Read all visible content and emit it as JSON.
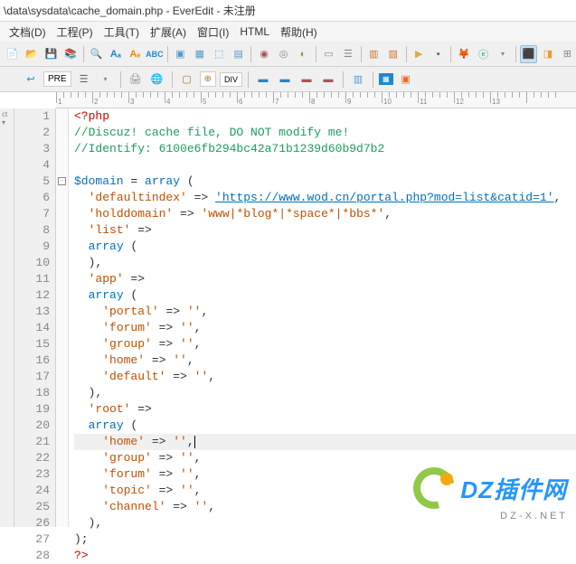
{
  "title": "\\data\\sysdata\\cache_domain.php - EverEdit - 未注册",
  "menu": [
    "文档(D)",
    "工程(P)",
    "工具(T)",
    "扩展(A)",
    "窗口(I)",
    "HTML",
    "帮助(H)"
  ],
  "toolbar2": {
    "pre_label": "PRE"
  },
  "ruler": {
    "marks": [
      1,
      2,
      3,
      4,
      5,
      6,
      7,
      8,
      9,
      10,
      11,
      12,
      13
    ]
  },
  "code": {
    "lines": [
      {
        "n": 1,
        "t": "php_open",
        "txt": "<?php"
      },
      {
        "n": 2,
        "t": "comment",
        "txt": "//Discuz! cache file, DO NOT modify me!"
      },
      {
        "n": 3,
        "t": "comment",
        "txt": "//Identify: 6100e6fb294bc42a71b1239d60b9d7b2"
      },
      {
        "n": 4,
        "t": "blank",
        "txt": ""
      },
      {
        "n": 5,
        "t": "code",
        "fold": true,
        "parts": [
          {
            "c": "var",
            "v": "$domain"
          },
          {
            "c": "",
            "v": " = "
          },
          {
            "c": "kw",
            "v": "array"
          },
          {
            "c": "",
            "v": " ("
          }
        ]
      },
      {
        "n": 6,
        "t": "code",
        "parts": [
          {
            "c": "",
            "v": "  "
          },
          {
            "c": "str",
            "v": "'defaultindex'"
          },
          {
            "c": "",
            "v": " => "
          },
          {
            "c": "str link",
            "v": "'https://www.wod.cn/portal.php?mod=list&catid=1'"
          },
          {
            "c": "",
            "v": ","
          }
        ]
      },
      {
        "n": 7,
        "t": "code",
        "parts": [
          {
            "c": "",
            "v": "  "
          },
          {
            "c": "str",
            "v": "'holddomain'"
          },
          {
            "c": "",
            "v": " => "
          },
          {
            "c": "str",
            "v": "'www|*blog*|*space*|*bbs*'"
          },
          {
            "c": "",
            "v": ","
          }
        ]
      },
      {
        "n": 8,
        "t": "code",
        "parts": [
          {
            "c": "",
            "v": "  "
          },
          {
            "c": "str",
            "v": "'list'"
          },
          {
            "c": "",
            "v": " => "
          }
        ]
      },
      {
        "n": 9,
        "t": "code",
        "parts": [
          {
            "c": "",
            "v": "  "
          },
          {
            "c": "kw",
            "v": "array"
          },
          {
            "c": "",
            "v": " ("
          }
        ]
      },
      {
        "n": 10,
        "t": "code",
        "parts": [
          {
            "c": "",
            "v": "  ),"
          }
        ]
      },
      {
        "n": 11,
        "t": "code",
        "parts": [
          {
            "c": "",
            "v": "  "
          },
          {
            "c": "str",
            "v": "'app'"
          },
          {
            "c": "",
            "v": " => "
          }
        ]
      },
      {
        "n": 12,
        "t": "code",
        "parts": [
          {
            "c": "",
            "v": "  "
          },
          {
            "c": "kw",
            "v": "array"
          },
          {
            "c": "",
            "v": " ("
          }
        ]
      },
      {
        "n": 13,
        "t": "code",
        "parts": [
          {
            "c": "",
            "v": "    "
          },
          {
            "c": "str",
            "v": "'portal'"
          },
          {
            "c": "",
            "v": " => "
          },
          {
            "c": "str",
            "v": "''"
          },
          {
            "c": "",
            "v": ","
          }
        ]
      },
      {
        "n": 14,
        "t": "code",
        "parts": [
          {
            "c": "",
            "v": "    "
          },
          {
            "c": "str",
            "v": "'forum'"
          },
          {
            "c": "",
            "v": " => "
          },
          {
            "c": "str",
            "v": "''"
          },
          {
            "c": "",
            "v": ","
          }
        ]
      },
      {
        "n": 15,
        "t": "code",
        "parts": [
          {
            "c": "",
            "v": "    "
          },
          {
            "c": "str",
            "v": "'group'"
          },
          {
            "c": "",
            "v": " => "
          },
          {
            "c": "str",
            "v": "''"
          },
          {
            "c": "",
            "v": ","
          }
        ]
      },
      {
        "n": 16,
        "t": "code",
        "parts": [
          {
            "c": "",
            "v": "    "
          },
          {
            "c": "str",
            "v": "'home'"
          },
          {
            "c": "",
            "v": " => "
          },
          {
            "c": "str",
            "v": "''"
          },
          {
            "c": "",
            "v": ","
          }
        ]
      },
      {
        "n": 17,
        "t": "code",
        "parts": [
          {
            "c": "",
            "v": "    "
          },
          {
            "c": "str",
            "v": "'default'"
          },
          {
            "c": "",
            "v": " => "
          },
          {
            "c": "str",
            "v": "''"
          },
          {
            "c": "",
            "v": ","
          }
        ]
      },
      {
        "n": 18,
        "t": "code",
        "parts": [
          {
            "c": "",
            "v": "  ),"
          }
        ]
      },
      {
        "n": 19,
        "t": "code",
        "parts": [
          {
            "c": "",
            "v": "  "
          },
          {
            "c": "str",
            "v": "'root'"
          },
          {
            "c": "",
            "v": " => "
          }
        ]
      },
      {
        "n": 20,
        "t": "code",
        "parts": [
          {
            "c": "",
            "v": "  "
          },
          {
            "c": "kw",
            "v": "array"
          },
          {
            "c": "",
            "v": " ("
          }
        ]
      },
      {
        "n": 21,
        "t": "code",
        "hl": true,
        "cursor": true,
        "parts": [
          {
            "c": "",
            "v": "    "
          },
          {
            "c": "str",
            "v": "'home'"
          },
          {
            "c": "",
            "v": " => "
          },
          {
            "c": "str",
            "v": "''"
          },
          {
            "c": "",
            "v": ","
          }
        ]
      },
      {
        "n": 22,
        "t": "code",
        "parts": [
          {
            "c": "",
            "v": "    "
          },
          {
            "c": "str",
            "v": "'group'"
          },
          {
            "c": "",
            "v": " => "
          },
          {
            "c": "str",
            "v": "''"
          },
          {
            "c": "",
            "v": ","
          }
        ]
      },
      {
        "n": 23,
        "t": "code",
        "parts": [
          {
            "c": "",
            "v": "    "
          },
          {
            "c": "str",
            "v": "'forum'"
          },
          {
            "c": "",
            "v": " => "
          },
          {
            "c": "str",
            "v": "''"
          },
          {
            "c": "",
            "v": ","
          }
        ]
      },
      {
        "n": 24,
        "t": "code",
        "parts": [
          {
            "c": "",
            "v": "    "
          },
          {
            "c": "str",
            "v": "'topic'"
          },
          {
            "c": "",
            "v": " => "
          },
          {
            "c": "str",
            "v": "''"
          },
          {
            "c": "",
            "v": ","
          }
        ]
      },
      {
        "n": 25,
        "t": "code",
        "parts": [
          {
            "c": "",
            "v": "    "
          },
          {
            "c": "str",
            "v": "'channel'"
          },
          {
            "c": "",
            "v": " => "
          },
          {
            "c": "str",
            "v": "''"
          },
          {
            "c": "",
            "v": ","
          }
        ]
      },
      {
        "n": 26,
        "t": "code",
        "parts": [
          {
            "c": "",
            "v": "  ),"
          }
        ]
      },
      {
        "n": 27,
        "t": "code",
        "parts": [
          {
            "c": "",
            "v": ");"
          }
        ]
      },
      {
        "n": 28,
        "t": "php_close",
        "txt": "?>"
      }
    ]
  },
  "watermark": {
    "brand": "DZ插件网",
    "sub": "D Z - X . N E T"
  }
}
